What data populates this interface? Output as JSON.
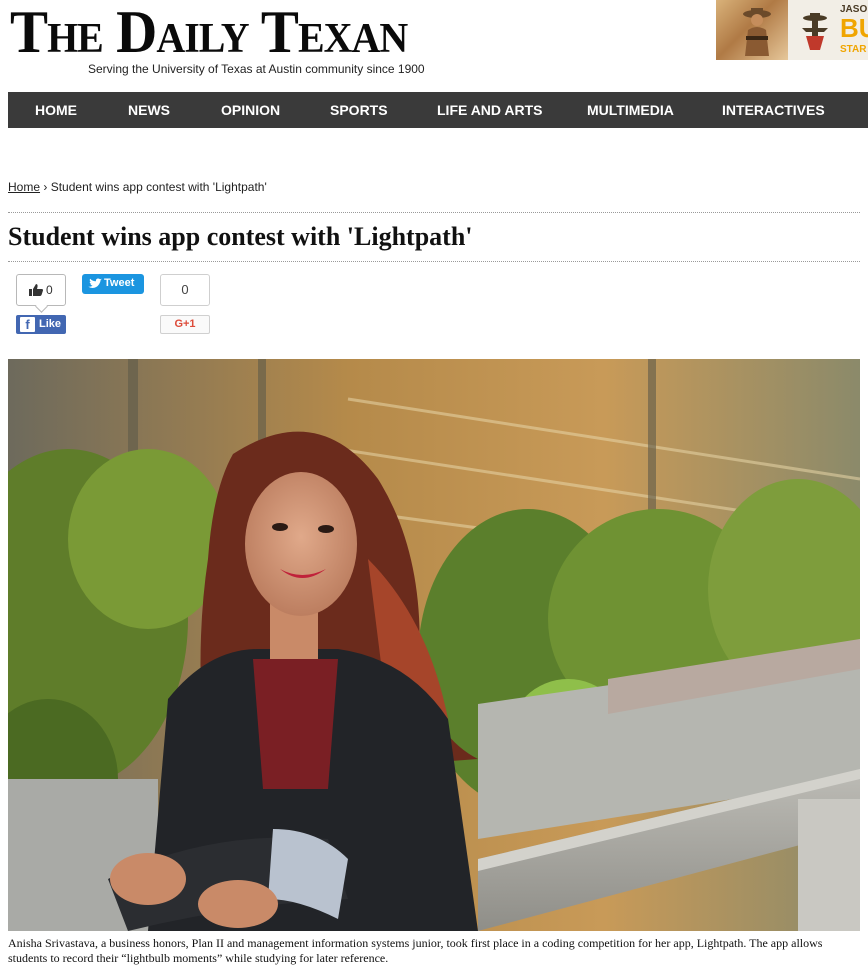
{
  "masthead": {
    "title": "The Daily Texan",
    "tagline": "Serving the University of Texas at Austin community since 1900"
  },
  "ad": {
    "text_top": "JASO",
    "text_big": "BU",
    "text_sub": "STAR",
    "brand_color": "#f0a500"
  },
  "nav": {
    "items": [
      {
        "label": "HOME"
      },
      {
        "label": "NEWS"
      },
      {
        "label": "OPINION"
      },
      {
        "label": "SPORTS"
      },
      {
        "label": "LIFE AND ARTS"
      },
      {
        "label": "MULTIMEDIA"
      },
      {
        "label": "INTERACTIVES"
      }
    ],
    "bg_color": "#3a3a3a"
  },
  "breadcrumb": {
    "home": "Home",
    "separator": "›",
    "current": "Student wins app contest with 'Lightpath'"
  },
  "article": {
    "headline": "Student wins app contest with 'Lightpath'",
    "caption": "Anisha Srivastava, a business honors, Plan II and management information systems junior, took first place in a coding competition for her app, Lightpath. The app allows students to record their “lightbulb moments” while studying for later reference."
  },
  "social": {
    "like_count": "0",
    "like_label": "Like",
    "tweet_label": "Tweet",
    "gplus_count": "0",
    "gplus_label": "G+1",
    "facebook_color": "#4267b2",
    "twitter_color": "#1b95e0",
    "gplus_color": "#dd4b39"
  },
  "icons": {
    "thumb": "thumbs-up-icon",
    "facebook": "facebook-icon",
    "twitter": "twitter-bird-icon"
  }
}
